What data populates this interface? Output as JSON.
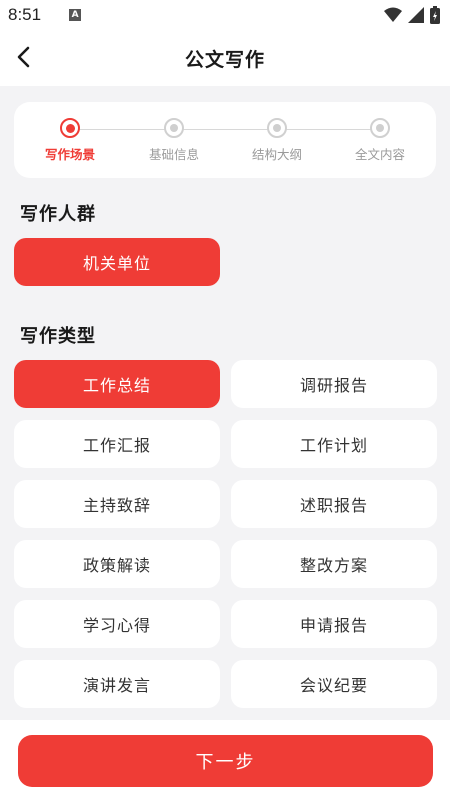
{
  "status_bar": {
    "time": "8:51",
    "notif": "A"
  },
  "header": {
    "title": "公文写作"
  },
  "steps": [
    {
      "label": "写作场景",
      "active": true
    },
    {
      "label": "基础信息",
      "active": false
    },
    {
      "label": "结构大纲",
      "active": false
    },
    {
      "label": "全文内容",
      "active": false
    }
  ],
  "audience": {
    "title": "写作人群",
    "options": [
      {
        "label": "机关单位",
        "selected": true
      }
    ]
  },
  "types": {
    "title": "写作类型",
    "options": [
      {
        "label": "工作总结",
        "selected": true
      },
      {
        "label": "调研报告",
        "selected": false
      },
      {
        "label": "工作汇报",
        "selected": false
      },
      {
        "label": "工作计划",
        "selected": false
      },
      {
        "label": "主持致辞",
        "selected": false
      },
      {
        "label": "述职报告",
        "selected": false
      },
      {
        "label": "政策解读",
        "selected": false
      },
      {
        "label": "整改方案",
        "selected": false
      },
      {
        "label": "学习心得",
        "selected": false
      },
      {
        "label": "申请报告",
        "selected": false
      },
      {
        "label": "演讲发言",
        "selected": false
      },
      {
        "label": "会议纪要",
        "selected": false
      }
    ]
  },
  "footer": {
    "next_label": "下一步"
  },
  "colors": {
    "accent": "#ef3c36",
    "background": "#f3f3f5"
  }
}
